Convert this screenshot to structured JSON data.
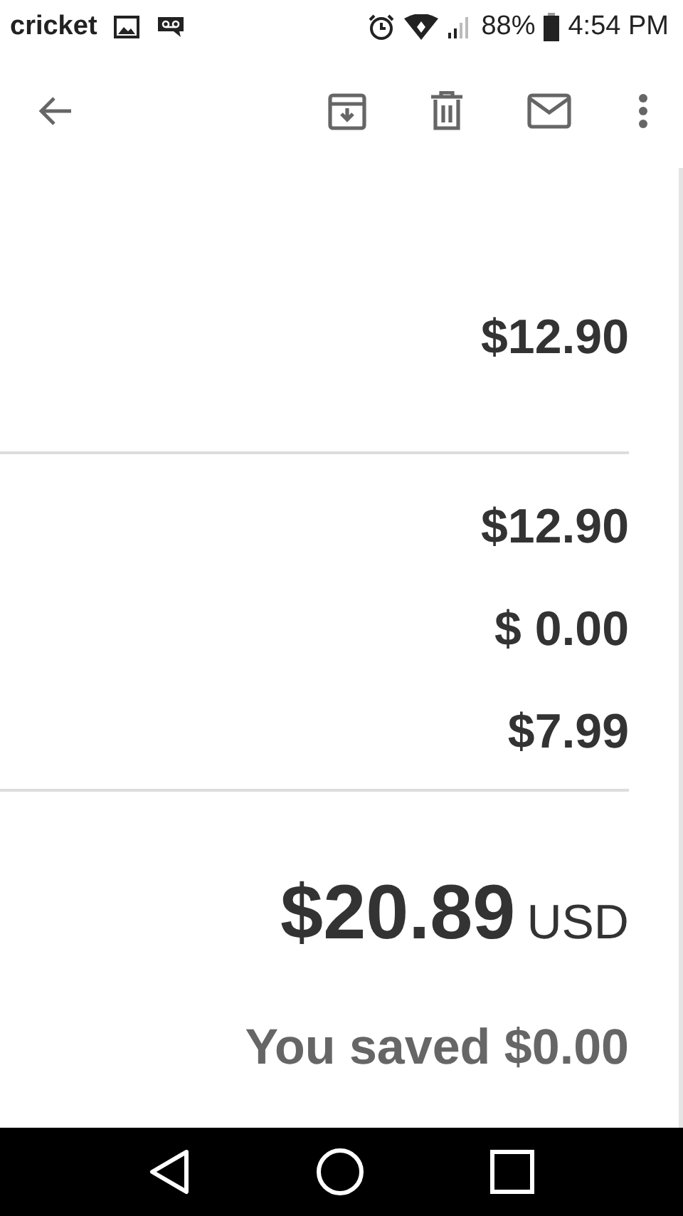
{
  "status_bar": {
    "carrier": "cricket",
    "battery": "88%",
    "time": "4:54 PM"
  },
  "subtotal": "$12.90",
  "lines": [
    "$12.90",
    "$ 0.00",
    "$7.99"
  ],
  "total": {
    "amount": "$20.89",
    "currency": "USD"
  },
  "savings": "You saved $0.00"
}
